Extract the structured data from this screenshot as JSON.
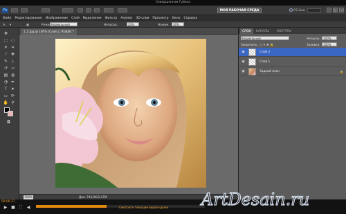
{
  "window": {
    "title": "Севершенная Губаза"
  },
  "appbar": {
    "logo": "Ps",
    "workspace": "МОЯ РАБОЧАЯ СРЕДА",
    "cslive": "CS Live"
  },
  "menu": [
    "Файл",
    "Редактирование",
    "Изображение",
    "Слой",
    "Выделение",
    "Фильтр",
    "Анализ",
    "3D-слои",
    "Просмотр",
    "Окно",
    "Справка"
  ],
  "options": {
    "mode_label": "Режим:",
    "mode_value": "Нормальный",
    "opacity_label": "Непрозр.:",
    "opacity_value": "20%",
    "pressure_label": "Нажим:",
    "pressure_value": "30%"
  },
  "document": {
    "tab": "1_5.jpg @ 100% (Слой 2, RGB/8) *",
    "zoom": "100%",
    "info": "Док: 744,0К/2,47М"
  },
  "panel": {
    "tabs": [
      "СЛОИ",
      "КАНАЛЫ",
      "КОНТУРЫ"
    ],
    "blend_mode": "Нормальный",
    "opacity_label": "Непрозр.:",
    "opacity_value": "100%",
    "lock_label": "Закрепить:",
    "fill_label": "Заливка:",
    "fill_value": "100%",
    "layers": [
      {
        "name": "Слой 2",
        "selected": true,
        "thumb": "checker"
      },
      {
        "name": "Слой 1",
        "selected": false,
        "thumb": "checker"
      },
      {
        "name": "Задний план",
        "selected": false,
        "thumb": "photo"
      }
    ]
  },
  "player": {
    "time": "00:06:37",
    "caption": "Смотрите текущие видео-уроки",
    "progress": 0.42
  },
  "watermark": "ArtDesain.ru",
  "colors": {
    "accent": "#3a66c4",
    "player_accent": "#e08a10",
    "swatch_fg": "#000000",
    "swatch_bg": "#e7b6b6"
  }
}
